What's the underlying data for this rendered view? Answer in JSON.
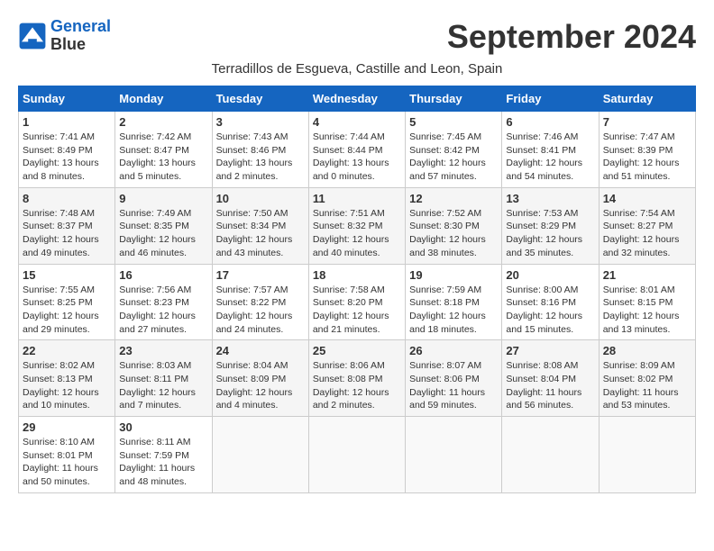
{
  "header": {
    "logo_line1": "General",
    "logo_line2": "Blue",
    "month_title": "September 2024",
    "subtitle": "Terradillos de Esgueva, Castille and Leon, Spain"
  },
  "days_of_week": [
    "Sunday",
    "Monday",
    "Tuesday",
    "Wednesday",
    "Thursday",
    "Friday",
    "Saturday"
  ],
  "weeks": [
    [
      {
        "day": "1",
        "sunrise": "7:41 AM",
        "sunset": "8:49 PM",
        "daylight": "13 hours and 8 minutes."
      },
      {
        "day": "2",
        "sunrise": "7:42 AM",
        "sunset": "8:47 PM",
        "daylight": "13 hours and 5 minutes."
      },
      {
        "day": "3",
        "sunrise": "7:43 AM",
        "sunset": "8:46 PM",
        "daylight": "13 hours and 2 minutes."
      },
      {
        "day": "4",
        "sunrise": "7:44 AM",
        "sunset": "8:44 PM",
        "daylight": "13 hours and 0 minutes."
      },
      {
        "day": "5",
        "sunrise": "7:45 AM",
        "sunset": "8:42 PM",
        "daylight": "12 hours and 57 minutes."
      },
      {
        "day": "6",
        "sunrise": "7:46 AM",
        "sunset": "8:41 PM",
        "daylight": "12 hours and 54 minutes."
      },
      {
        "day": "7",
        "sunrise": "7:47 AM",
        "sunset": "8:39 PM",
        "daylight": "12 hours and 51 minutes."
      }
    ],
    [
      {
        "day": "8",
        "sunrise": "7:48 AM",
        "sunset": "8:37 PM",
        "daylight": "12 hours and 49 minutes."
      },
      {
        "day": "9",
        "sunrise": "7:49 AM",
        "sunset": "8:35 PM",
        "daylight": "12 hours and 46 minutes."
      },
      {
        "day": "10",
        "sunrise": "7:50 AM",
        "sunset": "8:34 PM",
        "daylight": "12 hours and 43 minutes."
      },
      {
        "day": "11",
        "sunrise": "7:51 AM",
        "sunset": "8:32 PM",
        "daylight": "12 hours and 40 minutes."
      },
      {
        "day": "12",
        "sunrise": "7:52 AM",
        "sunset": "8:30 PM",
        "daylight": "12 hours and 38 minutes."
      },
      {
        "day": "13",
        "sunrise": "7:53 AM",
        "sunset": "8:29 PM",
        "daylight": "12 hours and 35 minutes."
      },
      {
        "day": "14",
        "sunrise": "7:54 AM",
        "sunset": "8:27 PM",
        "daylight": "12 hours and 32 minutes."
      }
    ],
    [
      {
        "day": "15",
        "sunrise": "7:55 AM",
        "sunset": "8:25 PM",
        "daylight": "12 hours and 29 minutes."
      },
      {
        "day": "16",
        "sunrise": "7:56 AM",
        "sunset": "8:23 PM",
        "daylight": "12 hours and 27 minutes."
      },
      {
        "day": "17",
        "sunrise": "7:57 AM",
        "sunset": "8:22 PM",
        "daylight": "12 hours and 24 minutes."
      },
      {
        "day": "18",
        "sunrise": "7:58 AM",
        "sunset": "8:20 PM",
        "daylight": "12 hours and 21 minutes."
      },
      {
        "day": "19",
        "sunrise": "7:59 AM",
        "sunset": "8:18 PM",
        "daylight": "12 hours and 18 minutes."
      },
      {
        "day": "20",
        "sunrise": "8:00 AM",
        "sunset": "8:16 PM",
        "daylight": "12 hours and 15 minutes."
      },
      {
        "day": "21",
        "sunrise": "8:01 AM",
        "sunset": "8:15 PM",
        "daylight": "12 hours and 13 minutes."
      }
    ],
    [
      {
        "day": "22",
        "sunrise": "8:02 AM",
        "sunset": "8:13 PM",
        "daylight": "12 hours and 10 minutes."
      },
      {
        "day": "23",
        "sunrise": "8:03 AM",
        "sunset": "8:11 PM",
        "daylight": "12 hours and 7 minutes."
      },
      {
        "day": "24",
        "sunrise": "8:04 AM",
        "sunset": "8:09 PM",
        "daylight": "12 hours and 4 minutes."
      },
      {
        "day": "25",
        "sunrise": "8:06 AM",
        "sunset": "8:08 PM",
        "daylight": "12 hours and 2 minutes."
      },
      {
        "day": "26",
        "sunrise": "8:07 AM",
        "sunset": "8:06 PM",
        "daylight": "11 hours and 59 minutes."
      },
      {
        "day": "27",
        "sunrise": "8:08 AM",
        "sunset": "8:04 PM",
        "daylight": "11 hours and 56 minutes."
      },
      {
        "day": "28",
        "sunrise": "8:09 AM",
        "sunset": "8:02 PM",
        "daylight": "11 hours and 53 minutes."
      }
    ],
    [
      {
        "day": "29",
        "sunrise": "8:10 AM",
        "sunset": "8:01 PM",
        "daylight": "11 hours and 50 minutes."
      },
      {
        "day": "30",
        "sunrise": "8:11 AM",
        "sunset": "7:59 PM",
        "daylight": "11 hours and 48 minutes."
      },
      null,
      null,
      null,
      null,
      null
    ]
  ]
}
